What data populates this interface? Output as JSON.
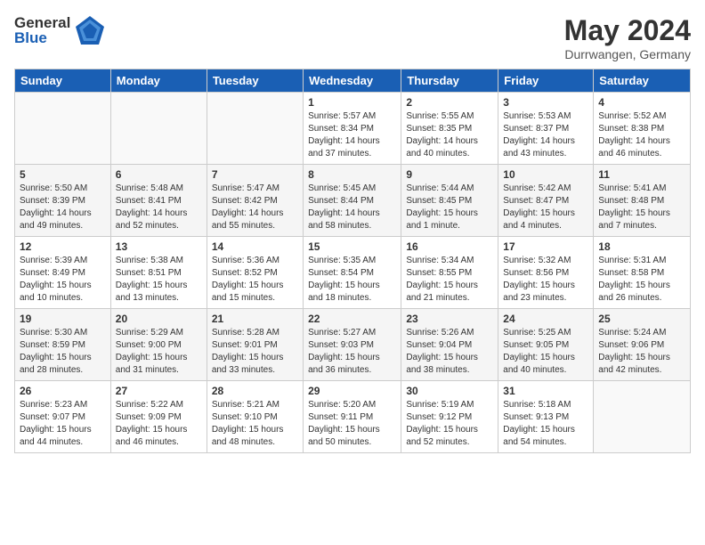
{
  "header": {
    "logo_general": "General",
    "logo_blue": "Blue",
    "month_title": "May 2024",
    "subtitle": "Durrwangen, Germany"
  },
  "days_of_week": [
    "Sunday",
    "Monday",
    "Tuesday",
    "Wednesday",
    "Thursday",
    "Friday",
    "Saturday"
  ],
  "weeks": [
    [
      {
        "day": "",
        "info": ""
      },
      {
        "day": "",
        "info": ""
      },
      {
        "day": "",
        "info": ""
      },
      {
        "day": "1",
        "info": "Sunrise: 5:57 AM\nSunset: 8:34 PM\nDaylight: 14 hours\nand 37 minutes."
      },
      {
        "day": "2",
        "info": "Sunrise: 5:55 AM\nSunset: 8:35 PM\nDaylight: 14 hours\nand 40 minutes."
      },
      {
        "day": "3",
        "info": "Sunrise: 5:53 AM\nSunset: 8:37 PM\nDaylight: 14 hours\nand 43 minutes."
      },
      {
        "day": "4",
        "info": "Sunrise: 5:52 AM\nSunset: 8:38 PM\nDaylight: 14 hours\nand 46 minutes."
      }
    ],
    [
      {
        "day": "5",
        "info": "Sunrise: 5:50 AM\nSunset: 8:39 PM\nDaylight: 14 hours\nand 49 minutes."
      },
      {
        "day": "6",
        "info": "Sunrise: 5:48 AM\nSunset: 8:41 PM\nDaylight: 14 hours\nand 52 minutes."
      },
      {
        "day": "7",
        "info": "Sunrise: 5:47 AM\nSunset: 8:42 PM\nDaylight: 14 hours\nand 55 minutes."
      },
      {
        "day": "8",
        "info": "Sunrise: 5:45 AM\nSunset: 8:44 PM\nDaylight: 14 hours\nand 58 minutes."
      },
      {
        "day": "9",
        "info": "Sunrise: 5:44 AM\nSunset: 8:45 PM\nDaylight: 15 hours\nand 1 minute."
      },
      {
        "day": "10",
        "info": "Sunrise: 5:42 AM\nSunset: 8:47 PM\nDaylight: 15 hours\nand 4 minutes."
      },
      {
        "day": "11",
        "info": "Sunrise: 5:41 AM\nSunset: 8:48 PM\nDaylight: 15 hours\nand 7 minutes."
      }
    ],
    [
      {
        "day": "12",
        "info": "Sunrise: 5:39 AM\nSunset: 8:49 PM\nDaylight: 15 hours\nand 10 minutes."
      },
      {
        "day": "13",
        "info": "Sunrise: 5:38 AM\nSunset: 8:51 PM\nDaylight: 15 hours\nand 13 minutes."
      },
      {
        "day": "14",
        "info": "Sunrise: 5:36 AM\nSunset: 8:52 PM\nDaylight: 15 hours\nand 15 minutes."
      },
      {
        "day": "15",
        "info": "Sunrise: 5:35 AM\nSunset: 8:54 PM\nDaylight: 15 hours\nand 18 minutes."
      },
      {
        "day": "16",
        "info": "Sunrise: 5:34 AM\nSunset: 8:55 PM\nDaylight: 15 hours\nand 21 minutes."
      },
      {
        "day": "17",
        "info": "Sunrise: 5:32 AM\nSunset: 8:56 PM\nDaylight: 15 hours\nand 23 minutes."
      },
      {
        "day": "18",
        "info": "Sunrise: 5:31 AM\nSunset: 8:58 PM\nDaylight: 15 hours\nand 26 minutes."
      }
    ],
    [
      {
        "day": "19",
        "info": "Sunrise: 5:30 AM\nSunset: 8:59 PM\nDaylight: 15 hours\nand 28 minutes."
      },
      {
        "day": "20",
        "info": "Sunrise: 5:29 AM\nSunset: 9:00 PM\nDaylight: 15 hours\nand 31 minutes."
      },
      {
        "day": "21",
        "info": "Sunrise: 5:28 AM\nSunset: 9:01 PM\nDaylight: 15 hours\nand 33 minutes."
      },
      {
        "day": "22",
        "info": "Sunrise: 5:27 AM\nSunset: 9:03 PM\nDaylight: 15 hours\nand 36 minutes."
      },
      {
        "day": "23",
        "info": "Sunrise: 5:26 AM\nSunset: 9:04 PM\nDaylight: 15 hours\nand 38 minutes."
      },
      {
        "day": "24",
        "info": "Sunrise: 5:25 AM\nSunset: 9:05 PM\nDaylight: 15 hours\nand 40 minutes."
      },
      {
        "day": "25",
        "info": "Sunrise: 5:24 AM\nSunset: 9:06 PM\nDaylight: 15 hours\nand 42 minutes."
      }
    ],
    [
      {
        "day": "26",
        "info": "Sunrise: 5:23 AM\nSunset: 9:07 PM\nDaylight: 15 hours\nand 44 minutes."
      },
      {
        "day": "27",
        "info": "Sunrise: 5:22 AM\nSunset: 9:09 PM\nDaylight: 15 hours\nand 46 minutes."
      },
      {
        "day": "28",
        "info": "Sunrise: 5:21 AM\nSunset: 9:10 PM\nDaylight: 15 hours\nand 48 minutes."
      },
      {
        "day": "29",
        "info": "Sunrise: 5:20 AM\nSunset: 9:11 PM\nDaylight: 15 hours\nand 50 minutes."
      },
      {
        "day": "30",
        "info": "Sunrise: 5:19 AM\nSunset: 9:12 PM\nDaylight: 15 hours\nand 52 minutes."
      },
      {
        "day": "31",
        "info": "Sunrise: 5:18 AM\nSunset: 9:13 PM\nDaylight: 15 hours\nand 54 minutes."
      },
      {
        "day": "",
        "info": ""
      }
    ]
  ]
}
